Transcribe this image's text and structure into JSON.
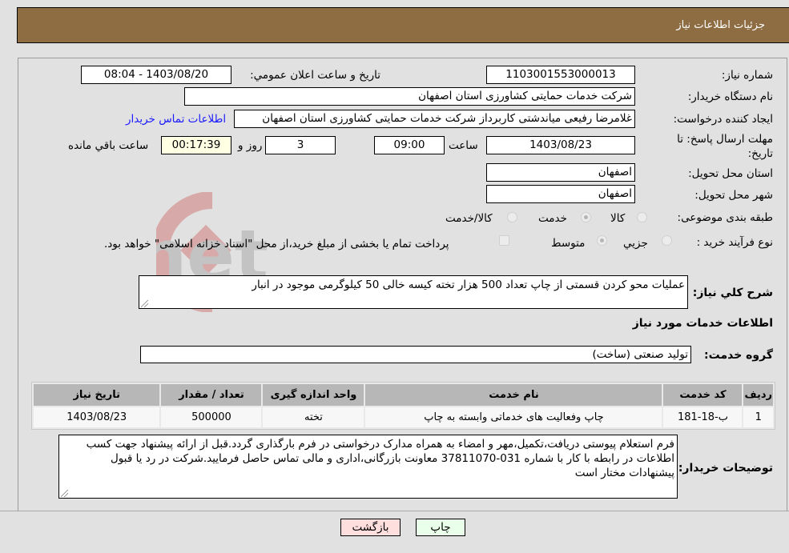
{
  "header": {
    "title": "جزئیات اطلاعات نیاز"
  },
  "fields": {
    "need_number_label": "شماره نیاز:",
    "need_number": "1103001553000013",
    "announce_label": "تاریخ و ساعت اعلان عمومي:",
    "announce_value": "1403/08/20 - 08:04",
    "buyer_org_label": "نام دستگاه خریدار:",
    "buyer_org": "شرکت خدمات حمایتی کشاورزی استان اصفهان",
    "creator_label": "ایجاد کننده درخواست:",
    "creator": "غلامرضا  رفیعی میاندشتی کاربرداز شرکت خدمات حمایتی کشاورزی استان اصفهان",
    "contact_link": "اطلاعات تماس خریدار",
    "deadline_label": "مهلت ارسال پاسخ: تا تاریخ:",
    "deadline_date": "1403/08/23",
    "time_label": "ساعت",
    "deadline_time": "09:00",
    "days_value": "3",
    "days_label": "روز و",
    "remaining_time": "00:17:39",
    "remaining_label": "ساعت باقي مانده",
    "province_label": "استان محل تحویل:",
    "province": "اصفهان",
    "city_label": "شهر محل تحویل:",
    "city": "اصفهان",
    "category_label": "طبقه بندی موضوعی:",
    "category_options": [
      {
        "label": "کالا",
        "selected": false
      },
      {
        "label": "خدمت",
        "selected": true
      },
      {
        "label": "کالا/خدمت",
        "selected": false
      }
    ],
    "process_label": "نوع فرآیند خرید :",
    "process_options": [
      {
        "label": "جزیي",
        "selected": false
      },
      {
        "label": "متوسط",
        "selected": true
      }
    ],
    "treasury_checkbox_label": "پرداخت تمام یا بخشی از مبلغ خرید،از محل \"اسناد خزانه اسلامی\" خواهد بود.",
    "treasury_checked": false
  },
  "summary": {
    "label": "شرح کلي نیاز:",
    "text": "عملیات محو کردن قسمتی از چاپ تعداد 500 هزار تخته کیسه خالی 50 کیلوگرمی موجود در انبار"
  },
  "services_section": {
    "title": "اطلاعات خدمات مورد نیاز",
    "group_label": "گروه خدمت:",
    "group_value": "تولید صنعتی (ساخت)"
  },
  "table": {
    "headers": [
      "ردیف",
      "کد خدمت",
      "نام خدمت",
      "واحد اندازه گیری",
      "تعداد / مقدار",
      "تاریخ نیاز"
    ],
    "rows": [
      [
        "1",
        "ب-18-181",
        "چاپ وفعالیت های خدماتی وابسته به چاپ",
        "تخته",
        "500000",
        "1403/08/23"
      ]
    ]
  },
  "buyer_notes": {
    "label": "توضیحات خریدار:",
    "text": "فرم استعلام پیوستی دریافت،تکمیل،مهر و امضاء به همراه مدارک درخواستی در فرم بارگذاری گردد.قبل از ارائه پیشنهاد جهت کسب اطلاعات در رابطه با کار با شماره 031-37811070 معاونت بازرگانی،اداری و مالی تماس حاصل فرمایید.شرکت در رد یا قبول پیشنهادات مختار است"
  },
  "buttons": {
    "print": "چاپ",
    "back": "بازگشت"
  },
  "watermark": "AriaTender.net",
  "colors": {
    "header_bg": "#8e6d42",
    "print_bg": "#eaffea",
    "back_bg": "#ffdede",
    "link": "#1a1aff"
  }
}
